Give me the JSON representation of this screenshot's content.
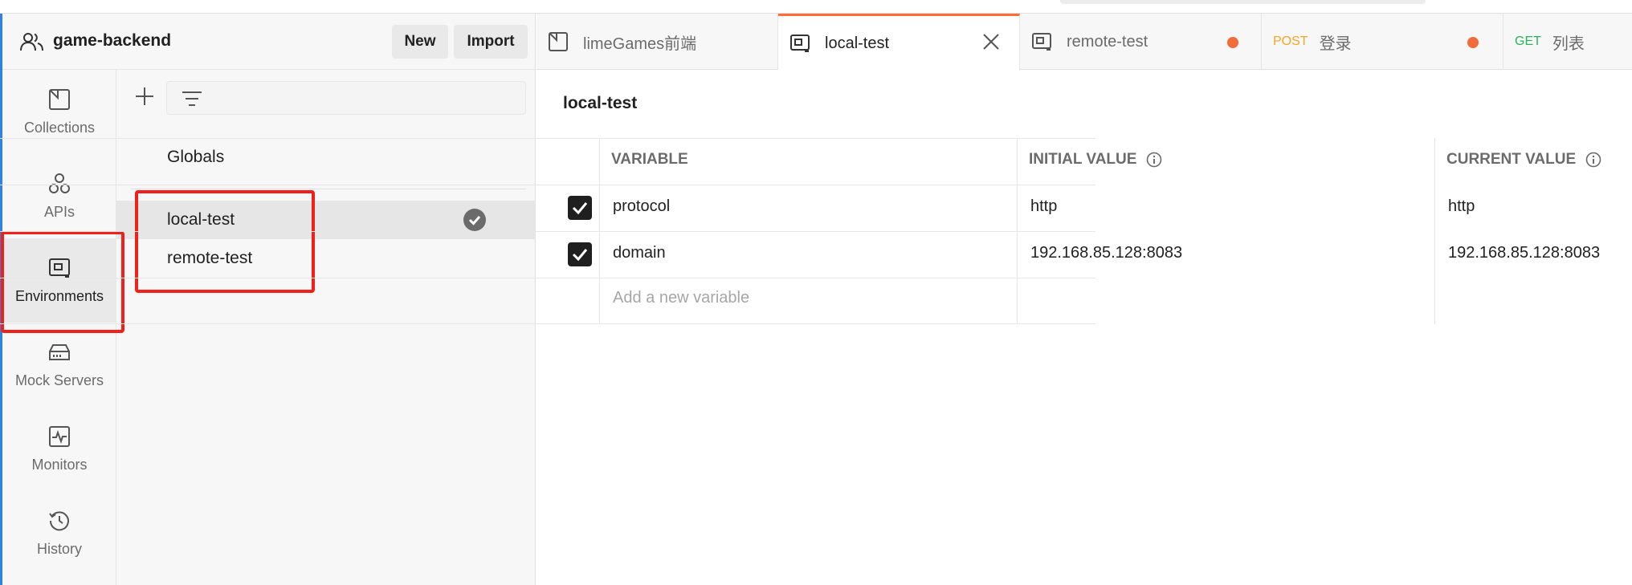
{
  "workspace": {
    "name": "game-backend",
    "new_label": "New",
    "import_label": "Import"
  },
  "sidebar": {
    "items": [
      {
        "label": "Collections",
        "icon": "collections-icon"
      },
      {
        "label": "APIs",
        "icon": "apis-icon"
      },
      {
        "label": "Environments",
        "icon": "environments-icon"
      },
      {
        "label": "Mock Servers",
        "icon": "mock-servers-icon"
      },
      {
        "label": "Monitors",
        "icon": "monitors-icon"
      },
      {
        "label": "History",
        "icon": "history-icon"
      }
    ]
  },
  "env_list": {
    "globals": "Globals",
    "items": [
      {
        "name": "local-test"
      },
      {
        "name": "remote-test"
      }
    ]
  },
  "tabs": [
    {
      "label": "limeGames前端"
    },
    {
      "label": "local-test"
    },
    {
      "label": "remote-test"
    },
    {
      "method": "POST",
      "label": "登录"
    },
    {
      "method": "GET",
      "label": "列表"
    }
  ],
  "main": {
    "title": "local-test",
    "columns": {
      "variable": "VARIABLE",
      "initial": "INITIAL VALUE",
      "current": "CURRENT VALUE"
    },
    "rows": [
      {
        "variable": "protocol",
        "initial": "http",
        "current": "http"
      },
      {
        "variable": "domain",
        "initial": "192.168.85.128:8083",
        "current": "192.168.85.128:8083"
      }
    ],
    "add_placeholder": "Add a new variable"
  },
  "colors": {
    "accent": "#ff6c37",
    "annotation_red": "#f0201a",
    "post_method": "#f5a623",
    "get_method": "#29b35a",
    "unsaved_dot": "#f26b3a"
  }
}
